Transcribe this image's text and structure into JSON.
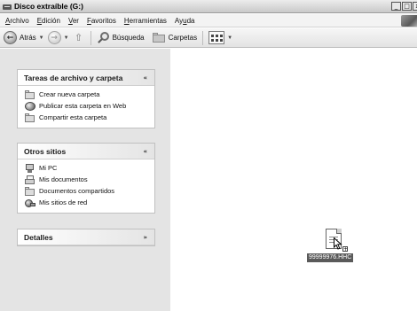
{
  "window": {
    "title": "Disco extraíble (G:)",
    "buttons": {
      "minimize": "_",
      "maximize": "□",
      "close": "x"
    }
  },
  "menubar": {
    "items": [
      {
        "prefix": "",
        "underline": "A",
        "rest": "rchivo"
      },
      {
        "prefix": "",
        "underline": "E",
        "rest": "dición"
      },
      {
        "prefix": "",
        "underline": "V",
        "rest": "er"
      },
      {
        "prefix": "",
        "underline": "F",
        "rest": "avoritos"
      },
      {
        "prefix": "",
        "underline": "H",
        "rest": "erramientas"
      },
      {
        "prefix": "Ay",
        "underline": "u",
        "rest": "da"
      }
    ]
  },
  "toolbar": {
    "back_label": "Atrás",
    "search_label": "Búsqueda",
    "folders_label": "Carpetas"
  },
  "taskpane": {
    "tasks": {
      "title": "Tareas de archivo y carpeta",
      "chevron": "«",
      "items": [
        {
          "label": "Crear nueva carpeta",
          "icon": "new-folder-icon"
        },
        {
          "label": "Publicar esta carpeta en Web",
          "icon": "publish-web-icon"
        },
        {
          "label": "Compartir esta carpeta",
          "icon": "share-folder-icon"
        }
      ]
    },
    "other_places": {
      "title": "Otros sitios",
      "chevron": "«",
      "items": [
        {
          "label": "Mi PC",
          "icon": "my-computer-icon"
        },
        {
          "label": "Mis documentos",
          "icon": "my-documents-icon"
        },
        {
          "label": "Documentos compartidos",
          "icon": "shared-documents-icon"
        },
        {
          "label": "Mis sitios de red",
          "icon": "network-places-icon"
        }
      ]
    },
    "details": {
      "title": "Detalles",
      "chevron": "»"
    }
  },
  "content": {
    "file": {
      "name": "99999976.HHC",
      "icon": "document-icon"
    }
  }
}
